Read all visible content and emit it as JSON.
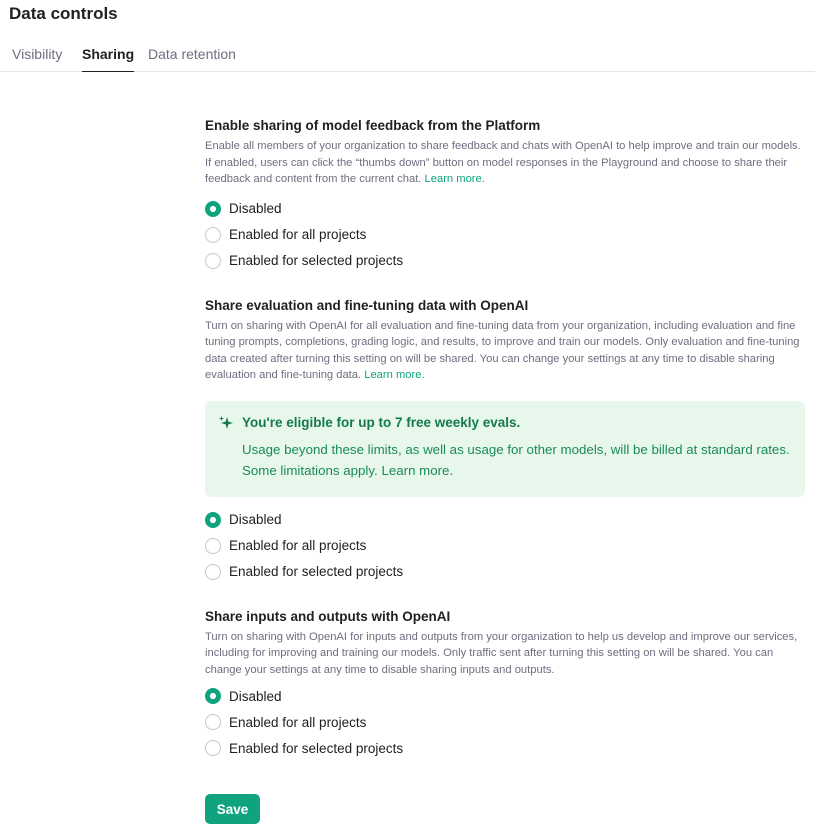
{
  "page": {
    "title": "Data controls"
  },
  "tabs": [
    {
      "label": "Visibility",
      "active": false
    },
    {
      "label": "Sharing",
      "active": true
    },
    {
      "label": "Data retention",
      "active": false
    }
  ],
  "sections": [
    {
      "title": "Enable sharing of model feedback from the Platform",
      "description": "Enable all members of your organization to share feedback and chats with OpenAI to help improve and train our models. If enabled, users can click the “thumbs down” button on model responses in the Playground and choose to share their feedback and content from the current chat.",
      "link": "Learn more.",
      "options": [
        "Disabled",
        "Enabled for all projects",
        "Enabled for selected projects"
      ],
      "selected": "Disabled"
    },
    {
      "title": "Share evaluation and fine-tuning data with OpenAI",
      "description": "Turn on sharing with OpenAI for all evaluation and fine-tuning data from your organization, including evaluation and fine tuning prompts, completions, grading logic, and results, to improve and train our models. Only evaluation and fine-tuning data created after turning this setting on will be shared. You can change your settings at any time to disable sharing evaluation and fine-tuning data.",
      "link": "Learn more.",
      "callout": {
        "icon": "sparkle-icon",
        "heading": "You're eligible for up to 7 free weekly evals.",
        "body": "Usage beyond these limits, as well as usage for other models, will be billed at standard rates. Some limitations apply.",
        "link": "Learn more."
      },
      "options": [
        "Disabled",
        "Enabled for all projects",
        "Enabled for selected projects"
      ],
      "selected": "Disabled"
    },
    {
      "title": "Share inputs and outputs with OpenAI",
      "description": "Turn on sharing with OpenAI for inputs and outputs from your organization to help us develop and improve our services, including for improving and training our models. Only traffic sent after turning this setting on will be shared. You can change your settings at any time to disable sharing inputs and outputs.",
      "link": "",
      "options": [
        "Disabled",
        "Enabled for all projects",
        "Enabled for selected projects"
      ],
      "selected": "Disabled"
    }
  ],
  "save_label": "Save",
  "colors": {
    "accent": "#10a37f",
    "callout_bg": "#e8f7ec",
    "callout_text": "#1a8a55"
  }
}
